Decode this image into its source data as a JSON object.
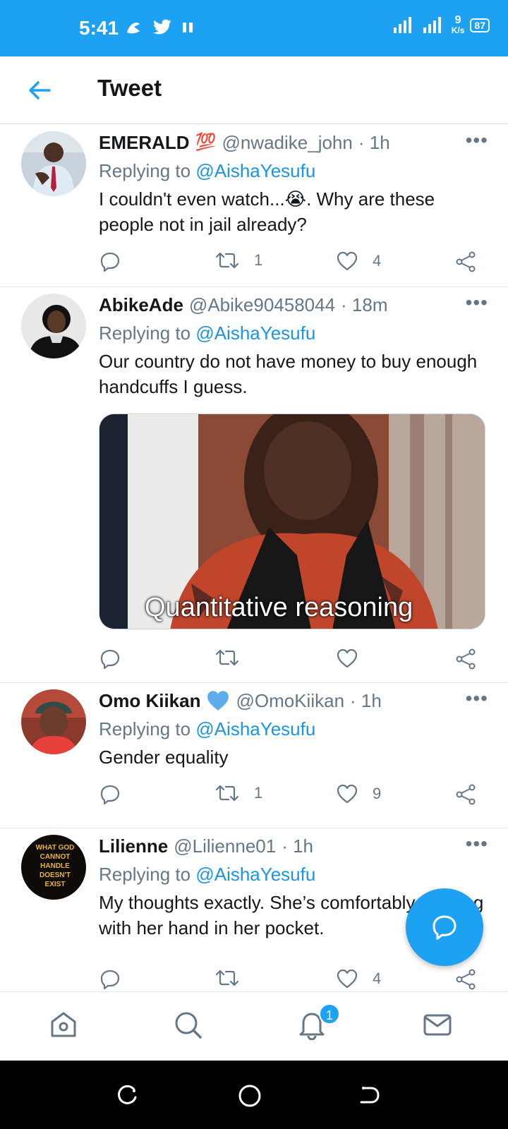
{
  "status_bar": {
    "time": "5:41",
    "network": "9",
    "speed_unit": "K/s",
    "battery": "87"
  },
  "header": {
    "title": "Tweet"
  },
  "tweets": [
    {
      "name": "EMERALD",
      "name_emoji": "💯",
      "handle": "@nwadike_john",
      "time": "· 1h",
      "replying_label": "Replying to",
      "replying_to": "@AishaYesufu",
      "text_part1": "I couldn't even watch...",
      "text_emoji": "😭",
      "text_part2": ". Why are these people not in jail already?",
      "retweets": "1",
      "likes": "4"
    },
    {
      "name": "AbikeAde",
      "handle": "@Abike90458044",
      "time": "· 18m",
      "replying_label": "Replying to",
      "replying_to": "@AishaYesufu",
      "text": "Our country do not have money to buy enough handcuffs I guess.",
      "media_caption": "Quantitative reasoning",
      "retweets": "",
      "likes": ""
    },
    {
      "name": "Omo Kiikan",
      "name_emoji": "💙",
      "handle": "@OmoKiikan",
      "time": "· 1h",
      "replying_label": "Replying to",
      "replying_to": "@AishaYesufu",
      "text": "Gender equality",
      "retweets": "1",
      "likes": "9"
    },
    {
      "name": "Lilienne",
      "handle": "@Lilienne01",
      "time": "· 1h",
      "replying_label": "Replying to",
      "replying_to": "@AishaYesufu",
      "text": "My thoughts exactly. She’s comfortably strolling with her hand in her pocket.",
      "avatar_text": "WHAT GOD CANNOT HANDLE DOESN'T EXIST",
      "retweets": "",
      "likes": "4"
    }
  ],
  "more_label": "•••",
  "bottom_nav": {
    "notifications_badge": "1",
    "items": [
      "home-icon",
      "search-icon",
      "notifications-icon",
      "messages-icon"
    ]
  },
  "colors": {
    "accent": "#1da1f2",
    "mention": "#1b95e0",
    "secondary_text": "#657786"
  }
}
